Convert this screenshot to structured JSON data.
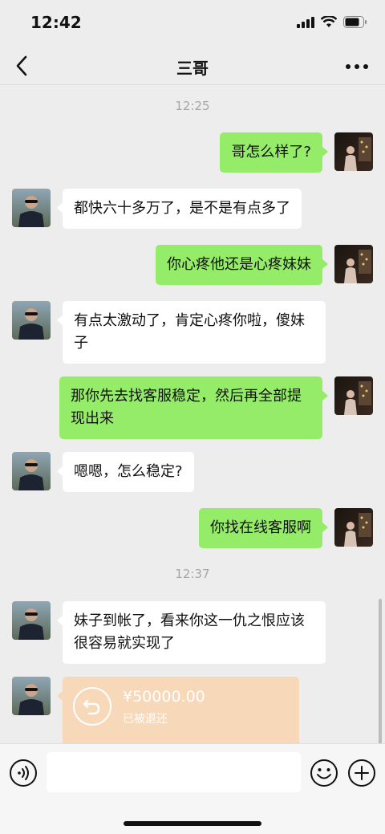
{
  "status_bar": {
    "time": "12:42"
  },
  "header": {
    "title": "三哥"
  },
  "messages": [
    {
      "kind": "time",
      "text": "12:25"
    },
    {
      "kind": "out",
      "text": "哥怎么样了?"
    },
    {
      "kind": "in",
      "text": "都快六十多万了，是不是有点多了"
    },
    {
      "kind": "out",
      "text": "你心疼他还是心疼妹妹"
    },
    {
      "kind": "in",
      "text": "有点太激动了，肯定心疼你啦，傻妹子"
    },
    {
      "kind": "out",
      "text": "那你先去找客服稳定，然后再全部提现出来"
    },
    {
      "kind": "in",
      "text": "嗯嗯，怎么稳定?"
    },
    {
      "kind": "out",
      "text": "你找在线客服啊"
    },
    {
      "kind": "time",
      "text": "12:37"
    },
    {
      "kind": "in",
      "text": "妹子到帐了，看来你这一仇之恨应该很容易就实现了"
    }
  ],
  "transfer": {
    "amount": "¥50000.00",
    "status": "已被退还"
  },
  "colors": {
    "outgoing_bubble": "#95ec69",
    "incoming_bubble": "#ffffff",
    "transfer_card": "#f7d8b9",
    "background": "#ededed"
  },
  "icons": [
    "back-icon",
    "more-icon",
    "voice-icon",
    "emoji-icon",
    "plus-icon",
    "transfer-return-icon",
    "signal-icon",
    "wifi-icon",
    "battery-icon"
  ]
}
